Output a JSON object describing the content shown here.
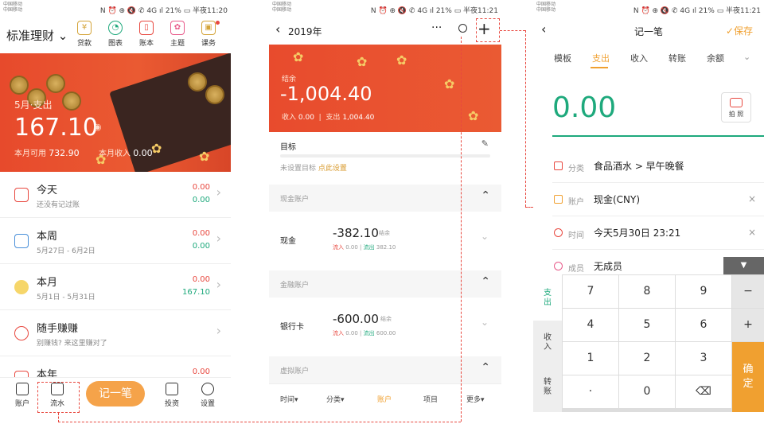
{
  "status": {
    "carrier1": "中国移动\n中国移动",
    "p1_right": "N ⏰ ⊕ 🔇 ✆ 4G ıl 21% ▭ 半夜11:20",
    "p2_right": "N ⏰ ⊕ 🔇 ✆ 4G ıl 21% ▭ 半夜11:21",
    "p3_right": "N ⏰ ⊕ 🔇 ✆ 4G ıl 21% ▭ 半夜11:21"
  },
  "home": {
    "title": "标准理财 ⌄",
    "icons": [
      {
        "icon": "loan-icon",
        "label": "贷款"
      },
      {
        "icon": "chart-icon",
        "label": "图表"
      },
      {
        "icon": "ledger-icon",
        "label": "账本"
      },
      {
        "icon": "theme-icon",
        "label": "主题"
      },
      {
        "icon": "course-icon",
        "label": "课务"
      }
    ],
    "banner": {
      "label": "5月·支出",
      "amount": "167.10",
      "available_label": "本月可用",
      "available_value": "732.90",
      "income_label": "本月收入",
      "income_value": "0.00"
    },
    "rows": [
      {
        "title": "今天",
        "sub": "还没有记过账",
        "v1": "0.00",
        "v2": "0.00"
      },
      {
        "title": "本周",
        "sub": "5月27日 - 6月2日",
        "v1": "0.00",
        "v2": "0.00"
      },
      {
        "title": "本月",
        "sub": "5月1日 - 5月31日",
        "v1": "0.00",
        "v2": "167.10"
      },
      {
        "title": "随手赚赚",
        "sub": "别赚钱? 来这里赚对了",
        "v1": "",
        "v2": ""
      },
      {
        "title": "本年",
        "sub": "",
        "v1": "0.00",
        "v2": ""
      }
    ],
    "tabs": {
      "account": "账户",
      "flow": "流水",
      "record": "记一笔",
      "invest": "投资",
      "settings": "设置"
    }
  },
  "accounts": {
    "year": "2019年",
    "more": "···",
    "plus": "+",
    "balance_label": "结余",
    "balance": "-1,004.40",
    "income_label": "收入",
    "income": "0.00",
    "expense_label": "支出",
    "expense": "1,004.40",
    "goal_title": "目标",
    "goal_sub": "未设置目标",
    "goal_link": "点此设置",
    "sections": [
      {
        "title": "现金账户",
        "name": "现金",
        "amount": "-382.10",
        "badge": "结余",
        "in_label": "流入",
        "in": "0.00",
        "out_label": "流出",
        "out": "382.10"
      },
      {
        "title": "金融账户",
        "name": "银行卡",
        "amount": "-600.00",
        "badge": "结余",
        "in_label": "流入",
        "in": "0.00",
        "out_label": "流出",
        "out": "600.00"
      },
      {
        "title": "虚拟账户"
      }
    ],
    "tabs": {
      "time": "时间▾",
      "category": "分类▾",
      "account": "账户",
      "project": "项目",
      "more": "更多▾"
    }
  },
  "record": {
    "title": "记一笔",
    "save": "✓保存",
    "tabs": [
      "模板",
      "支出",
      "收入",
      "转账",
      "余额"
    ],
    "amount": "0.00",
    "photo": "拍 照",
    "fields": [
      {
        "label": "分类",
        "value": "食品酒水 > 早午晚餐",
        "x": ""
      },
      {
        "label": "账户",
        "value": "现金(CNY)",
        "x": "×"
      },
      {
        "label": "时间",
        "value": "今天5月30日 23:21",
        "x": "×"
      },
      {
        "label": "成员",
        "value": "无成员",
        "x": ""
      }
    ],
    "keypad": {
      "side": [
        "支\n出",
        "收\n入",
        "转\n账"
      ],
      "keys": [
        "7",
        "8",
        "9",
        "−",
        "4",
        "5",
        "6",
        "+",
        "1",
        "2",
        "3",
        "",
        "·",
        "0",
        "⌫"
      ],
      "ok": "确\n定",
      "collapse": "▼"
    }
  }
}
